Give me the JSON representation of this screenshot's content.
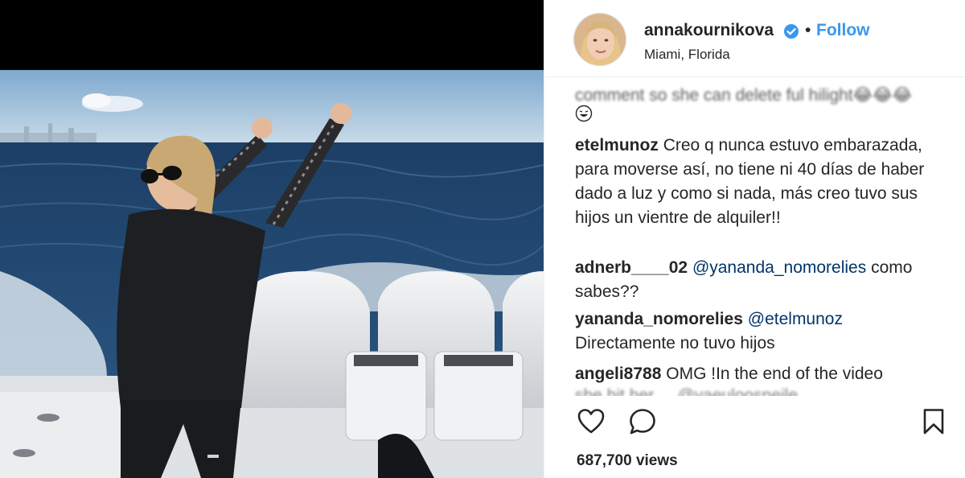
{
  "post": {
    "username": "annakournikova",
    "follow_label": "Follow",
    "separator": "•",
    "location": "Miami, Florida",
    "accent_color": "#3897f0"
  },
  "comments": {
    "truncated_top": "comment so she can delete ful hilight😂😂😂",
    "items": [
      {
        "user": "etelmunoz",
        "text": "Creo q nunca estuvo embarazada, para moverse así, no tiene ni 40 días de haber dado a luz y como si nada, más creo tuvo sus hijos un vientre de alquiler!!"
      },
      {
        "user": "adnerb____02",
        "mention": "@yananda_nomorelies",
        "text": "como sabes??"
      },
      {
        "user": "yananda_nomorelies",
        "mention": "@etelmunoz",
        "text": "Directamente no tuvo hijos"
      },
      {
        "user": "angeli8788",
        "text": "OMG !In the end of the video"
      }
    ],
    "truncated_bottom": "she hit her ... @yaeuloosneile"
  },
  "actions": {
    "views": "687,700 views",
    "icons": [
      "heart-icon",
      "comment-icon",
      "bookmark-icon"
    ]
  }
}
